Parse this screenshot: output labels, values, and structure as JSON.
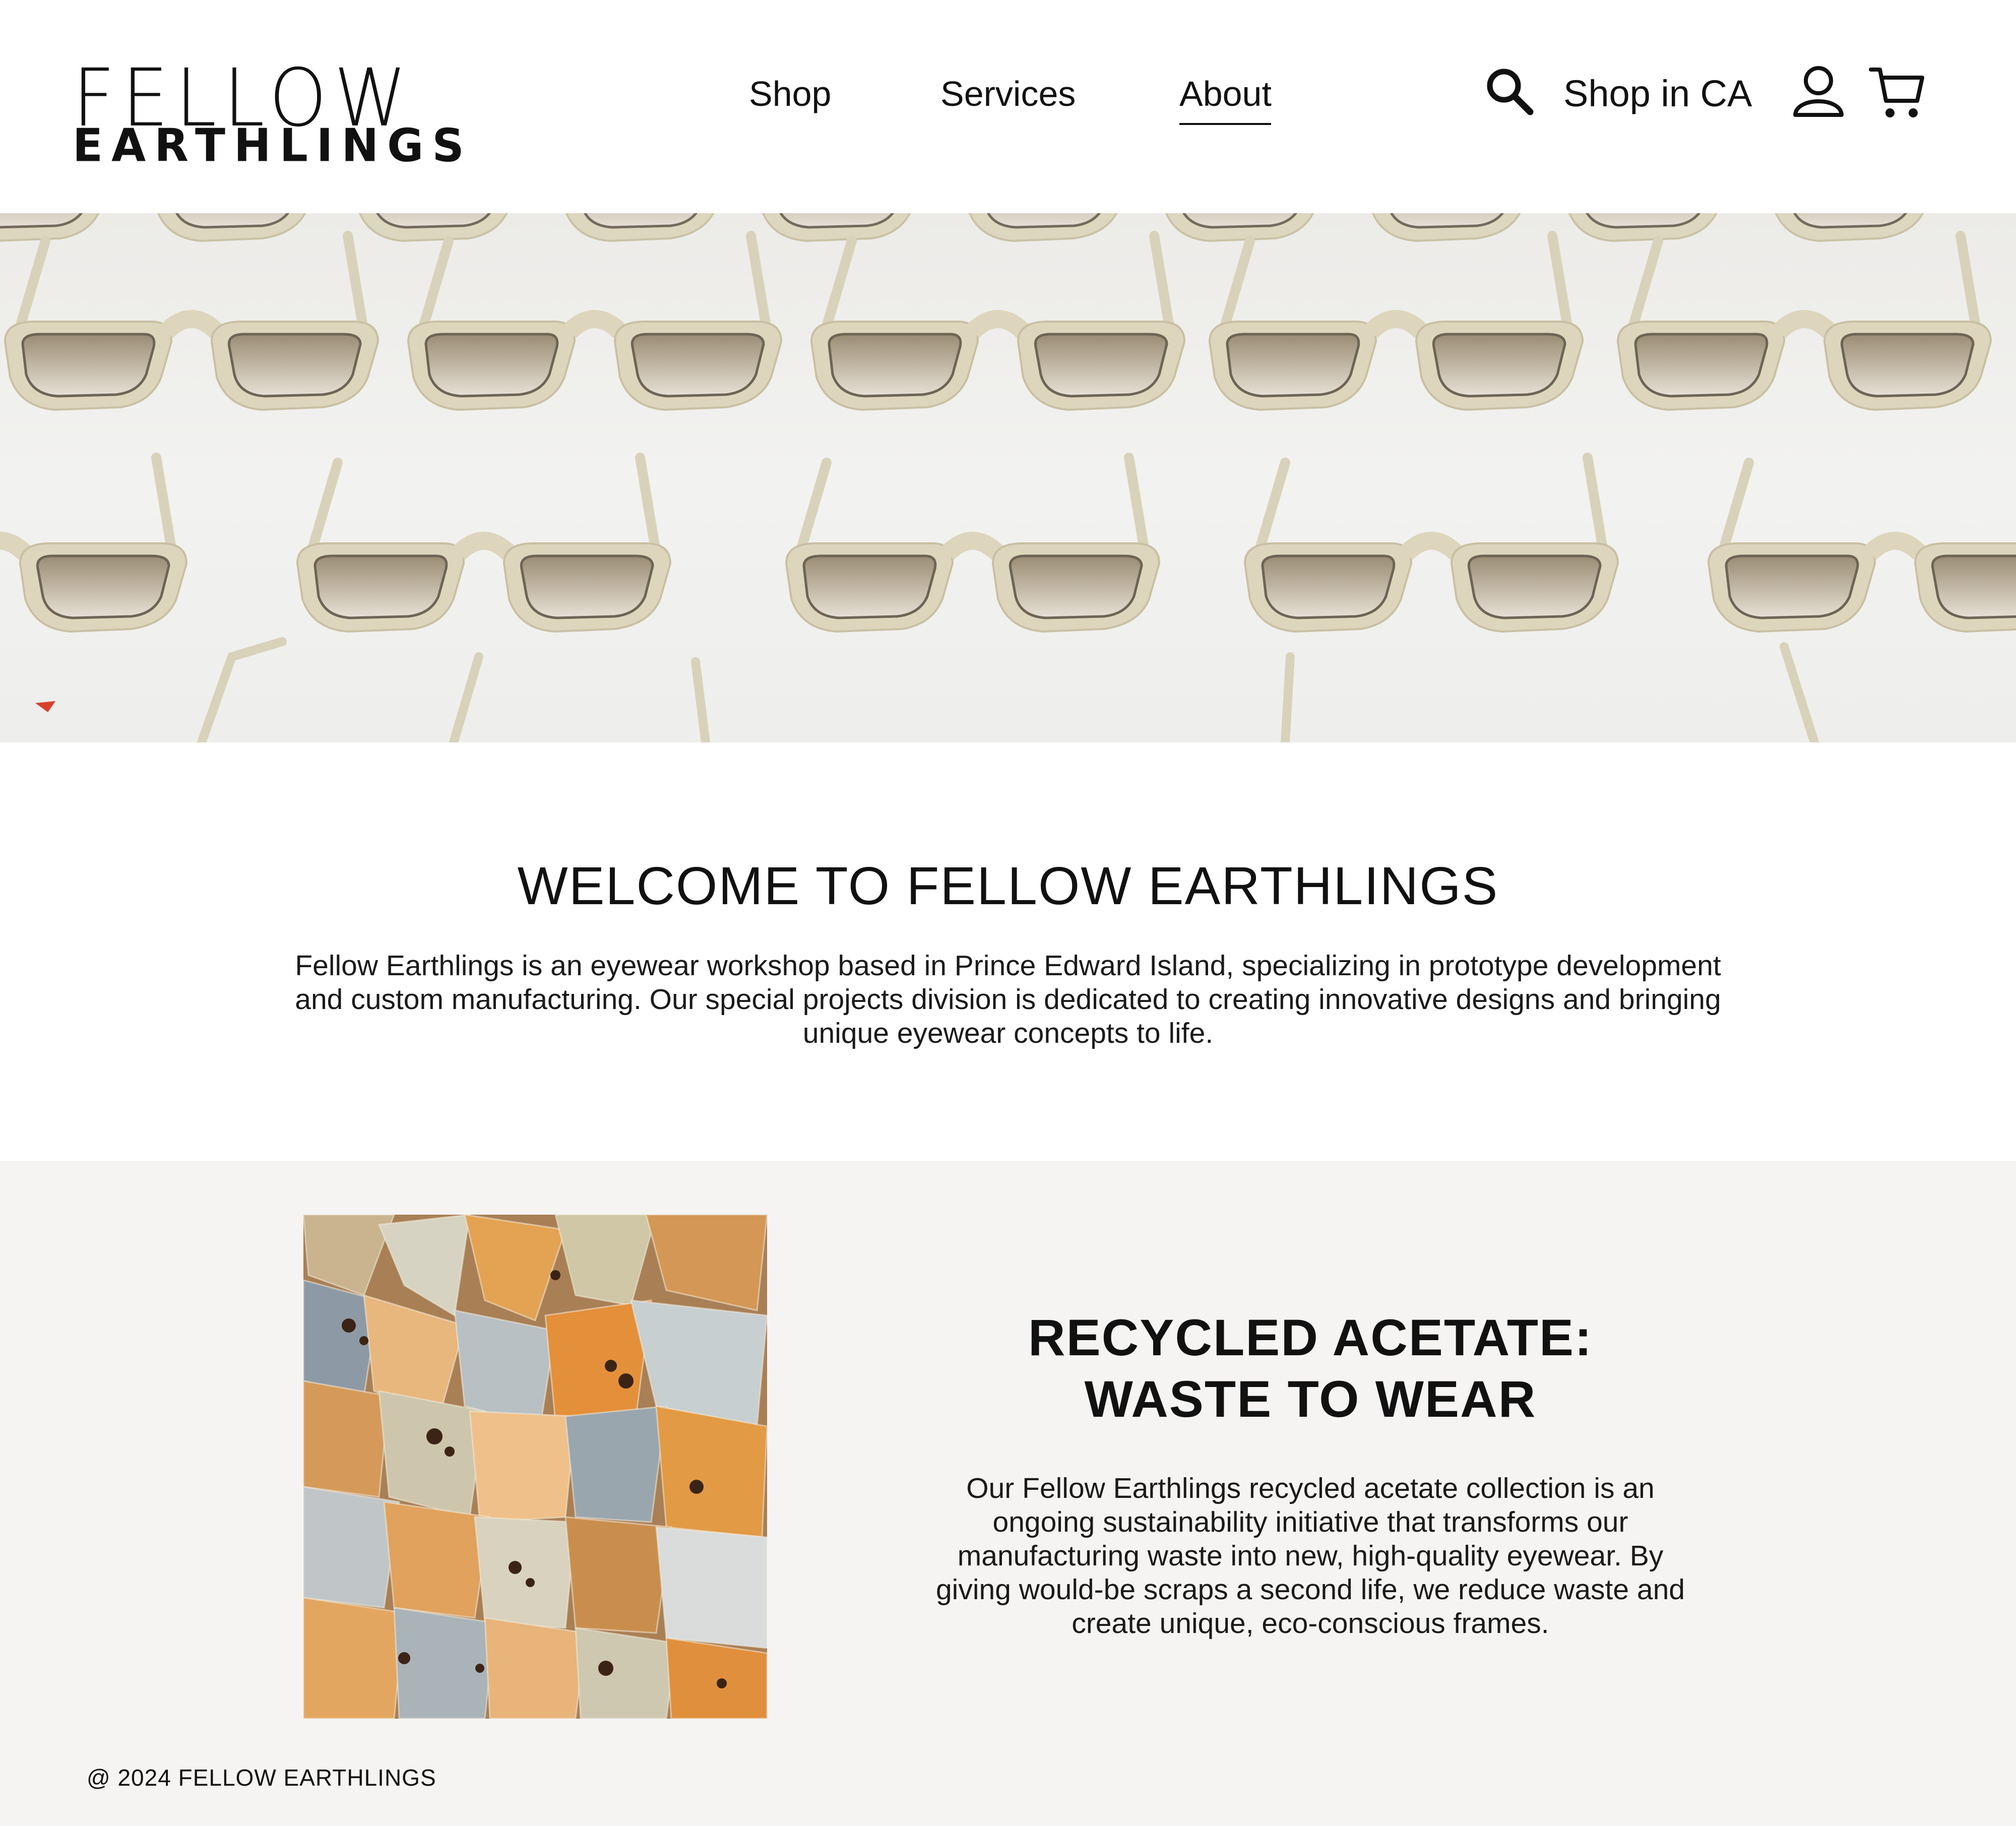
{
  "brand": {
    "logo_line1": "FELLOW",
    "logo_line2": "EARTHLINGS"
  },
  "nav": {
    "items": [
      "Shop",
      "Services",
      "About"
    ],
    "active": "About"
  },
  "utility": {
    "shop_region_label": "Shop in CA",
    "icons": [
      "search-icon",
      "account-icon",
      "cart-icon"
    ]
  },
  "hero": {
    "image": "rows of cream-colored sunglasses frames"
  },
  "welcome": {
    "title": "WELCOME TO FELLOW EARTHLINGS",
    "body": "Fellow Earthlings is an eyewear workshop based in Prince Edward Island, specializing in prototype development and custom manufacturing. Our special projects division is dedicated to creating innovative designs and bringing unique eyewear concepts to life."
  },
  "recycled": {
    "image": "pile of recycled acetate scraps",
    "title_line1": "RECYCLED ACETATE:",
    "title_line2": "WASTE TO WEAR",
    "body": "Our Fellow Earthlings recycled acetate collection is an ongoing sustainability initiative that transforms our manufacturing waste into new, high-quality eyewear. By giving would-be scraps a second life, we reduce waste and create unique, eco-conscious frames."
  },
  "footer": {
    "copyright": "@ 2024 FELLOW EARTHLINGS"
  },
  "colors": {
    "text": "#111111",
    "frame": "#ddd6bd",
    "lens": "#b3a58e",
    "section_bg": "#f5f4f2"
  }
}
